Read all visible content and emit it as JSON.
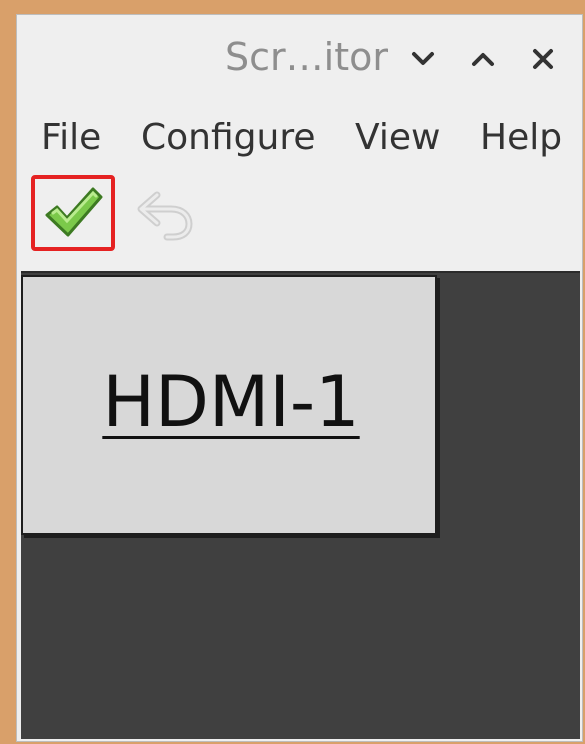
{
  "window": {
    "title": "Scr…itor",
    "controls": {
      "minimize_icon": "chevron-down-icon",
      "maximize_icon": "chevron-up-icon",
      "close_icon": "close-icon"
    }
  },
  "menubar": {
    "items": [
      {
        "label": "File"
      },
      {
        "label": "Configure"
      },
      {
        "label": "View"
      },
      {
        "label": "Help"
      }
    ]
  },
  "toolbar": {
    "apply_icon": "checkmark-icon",
    "apply_highlight_color": "#e52222",
    "undo_icon": "undo-icon",
    "undo_enabled": false
  },
  "canvas": {
    "background": "#404040",
    "monitors": [
      {
        "label": "HDMI-1"
      }
    ]
  }
}
